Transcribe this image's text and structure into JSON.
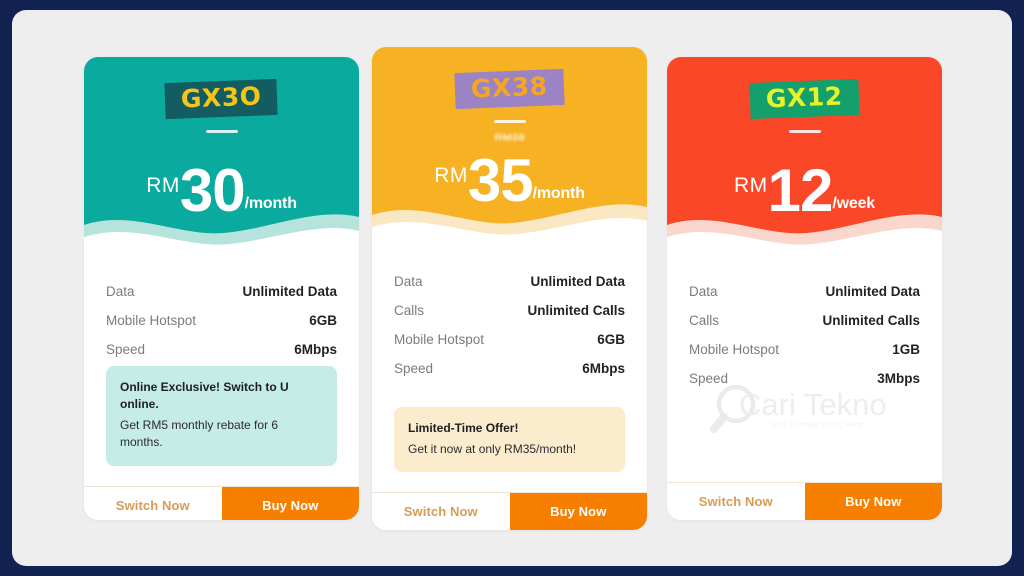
{
  "page": {
    "frame_color": "#112250",
    "stage_color": "#eeeeee"
  },
  "watermark": {
    "name": "Cari Tekno",
    "tagline": "Situs Teknologi Paling Besar"
  },
  "buttons": {
    "switch_label": "Switch Now",
    "buy_label": "Buy Now"
  },
  "cards": [
    {
      "plan": "GX3O",
      "badge_bg": "#125c62",
      "badge_color": "#f5c518",
      "header_bg": "#0aab9e",
      "wave_color": "#b6e4dd",
      "currency": "RM",
      "amount": "30",
      "period": "/month",
      "old_price": "",
      "specs": [
        {
          "label": "Data",
          "value": "Unlimited Data"
        },
        {
          "label": "Mobile Hotspot",
          "value": "6GB"
        },
        {
          "label": "Speed",
          "value": "6Mbps"
        }
      ],
      "promo_bg": "#c5ece6",
      "promo_title": "Online Exclusive! Switch to U online.",
      "promo_sub": "Get RM5 monthly rebate for 6 months."
    },
    {
      "plan": "GX38",
      "badge_bg": "#9b83c4",
      "badge_color": "#f5a623",
      "header_bg": "#f7b223",
      "wave_color": "#fae7c4",
      "currency": "RM",
      "amount": "35",
      "period": "/month",
      "old_price": "RM38",
      "specs": [
        {
          "label": "Data",
          "value": "Unlimited Data"
        },
        {
          "label": "Calls",
          "value": "Unlimited Calls"
        },
        {
          "label": "Mobile Hotspot",
          "value": "6GB"
        },
        {
          "label": "Speed",
          "value": "6Mbps"
        }
      ],
      "promo_bg": "#fbeccd",
      "promo_title": "Limited-Time Offer!",
      "promo_sub": "Get it now at only RM35/month!"
    },
    {
      "plan": "GX12",
      "badge_bg": "#13a06c",
      "badge_color": "#e8f22a",
      "header_bg": "#f94727",
      "wave_color": "#fbd6cd",
      "currency": "RM",
      "amount": "12",
      "period": "/week",
      "old_price": "",
      "specs": [
        {
          "label": "Data",
          "value": "Unlimited Data"
        },
        {
          "label": "Calls",
          "value": "Unlimited Calls"
        },
        {
          "label": "Mobile Hotspot",
          "value": "1GB"
        },
        {
          "label": "Speed",
          "value": "3Mbps"
        }
      ],
      "promo_bg": "",
      "promo_title": "",
      "promo_sub": ""
    }
  ]
}
